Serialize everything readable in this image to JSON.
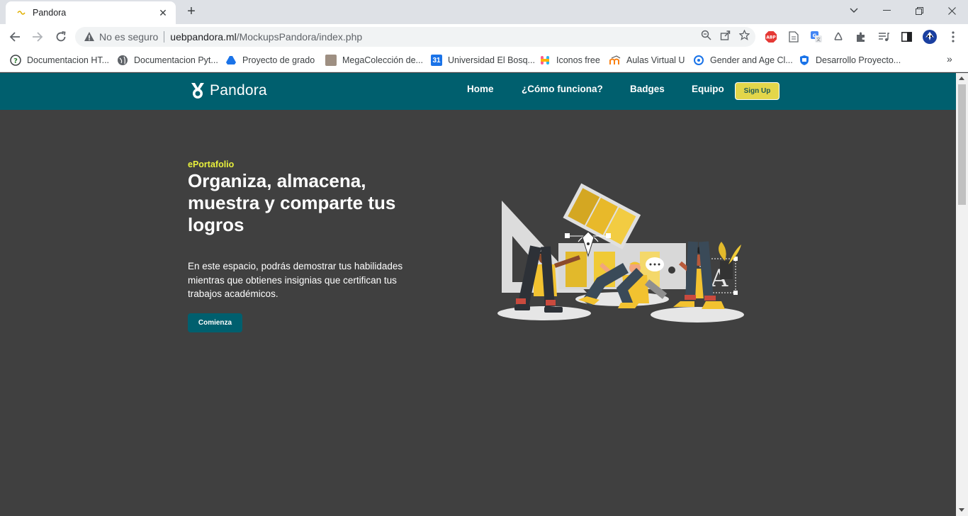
{
  "browser": {
    "tab_title": "Pandora",
    "security_label": "No es seguro",
    "url_host": "uebpandora.ml",
    "url_path": "/MockupsPandora/index.php"
  },
  "bookmarks": [
    {
      "label": "Documentacion HT..."
    },
    {
      "label": "Documentacion Pyt..."
    },
    {
      "label": "Proyecto de grado"
    },
    {
      "label": "MegaColección de..."
    },
    {
      "label": "Universidad El Bosq..."
    },
    {
      "label": "Iconos free"
    },
    {
      "label": "Aulas Virtual U"
    },
    {
      "label": "Gender and Age Cl..."
    },
    {
      "label": "Desarrollo Proyecto..."
    }
  ],
  "site": {
    "brand": "Pandora",
    "nav": {
      "home": "Home",
      "how": "¿Cómo funciona?",
      "badges": "Badges",
      "team": "Equipo",
      "signup": "Sign Up"
    },
    "hero": {
      "kicker": "ePortafolio",
      "headline": "Organiza, almacena, muestra y comparte tus logros",
      "lead": "En este espacio, podrás demostrar tus habilidades mientras que obtienes insignias que certifican tus trabajos académicos.",
      "cta": "Comienza"
    }
  },
  "colors": {
    "navbar": "#005f6e",
    "page_bg": "#404040",
    "accent_yellow": "#e8f03c",
    "signup_bg": "#e3d64a"
  }
}
